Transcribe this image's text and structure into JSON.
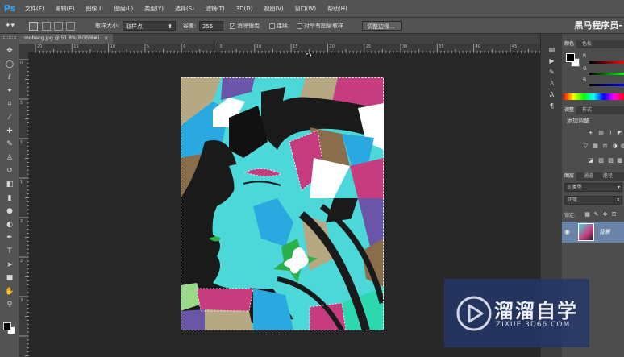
{
  "app": {
    "logo": "Ps",
    "brand_text": "黑马程序员-"
  },
  "menu": [
    "文件(F)",
    "编辑(E)",
    "图像(I)",
    "图层(L)",
    "类型(Y)",
    "选择(S)",
    "滤镜(T)",
    "3D(D)",
    "视图(V)",
    "窗口(W)",
    "帮助(H)"
  ],
  "options": {
    "sample_size_label": "取样大小:",
    "sample_size_value": "取样点",
    "tolerance_label": "容差:",
    "tolerance_value": "255",
    "antialias_label": "消除锯齿",
    "contiguous_label": "连续",
    "all_layers_label": "对所有图层取样",
    "refine_button": "调整边缘..."
  },
  "document": {
    "tab_label": "mobang.jpg @ 51.8%(RGB/8#)",
    "close_symbol": "×"
  },
  "rulers": {
    "h": [
      "20",
      "15",
      "10",
      "5",
      "0",
      "5",
      "10",
      "15",
      "20",
      "25",
      "30",
      "35",
      "40",
      "45",
      "50"
    ],
    "v": [
      "0",
      "5",
      "1",
      "1",
      "2",
      "2",
      "3"
    ]
  },
  "tools": [
    {
      "name": "move-tool-icon",
      "glyph": "✥"
    },
    {
      "name": "marquee-tool-icon",
      "glyph": "◯"
    },
    {
      "name": "lasso-tool-icon",
      "glyph": "ℓ"
    },
    {
      "name": "magic-wand-tool-icon",
      "glyph": "✦"
    },
    {
      "name": "crop-tool-icon",
      "glyph": "⌗"
    },
    {
      "name": "eyedropper-tool-icon",
      "glyph": "⁄"
    },
    {
      "name": "healing-brush-tool-icon",
      "glyph": "✚"
    },
    {
      "name": "brush-tool-icon",
      "glyph": "✎"
    },
    {
      "name": "clone-stamp-tool-icon",
      "glyph": "♙"
    },
    {
      "name": "history-brush-tool-icon",
      "glyph": "↺"
    },
    {
      "name": "eraser-tool-icon",
      "glyph": "◧"
    },
    {
      "name": "gradient-tool-icon",
      "glyph": "▮"
    },
    {
      "name": "blur-tool-icon",
      "glyph": "●"
    },
    {
      "name": "dodge-tool-icon",
      "glyph": "◐"
    },
    {
      "name": "pen-tool-icon",
      "glyph": "✒"
    },
    {
      "name": "type-tool-icon",
      "glyph": "T"
    },
    {
      "name": "path-selection-tool-icon",
      "glyph": "➤"
    },
    {
      "name": "shape-tool-icon",
      "glyph": "■"
    },
    {
      "name": "hand-tool-icon",
      "glyph": "✋"
    },
    {
      "name": "zoom-tool-icon",
      "glyph": "⚲"
    }
  ],
  "panels": {
    "color": {
      "tabs": [
        "颜色",
        "色板"
      ],
      "channels": [
        "R",
        "G",
        "B"
      ]
    },
    "adjustments": {
      "tabs": [
        "调整",
        "样式"
      ],
      "title": "添加调整"
    },
    "layers": {
      "tabs": [
        "图层",
        "通道",
        "路径"
      ],
      "filter": "ρ 类型",
      "blend_mode": "正常",
      "lock_label": "锁定:",
      "layer_name": "背景"
    }
  },
  "watermark": {
    "title": "溜溜自学",
    "url": "ZIXUE.3D66.COM"
  },
  "colors": {
    "menubar": "#535353",
    "art_cyan": "#4cd8d8",
    "art_magenta": "#c73b7f",
    "art_khaki": "#b5a883",
    "art_brown": "#8a6d4a",
    "art_purple": "#6b55a8",
    "art_blue": "#2aa8e0",
    "art_green": "#2bb04a",
    "art_black": "#1a1a1a",
    "watermark_bg": "#253769"
  }
}
